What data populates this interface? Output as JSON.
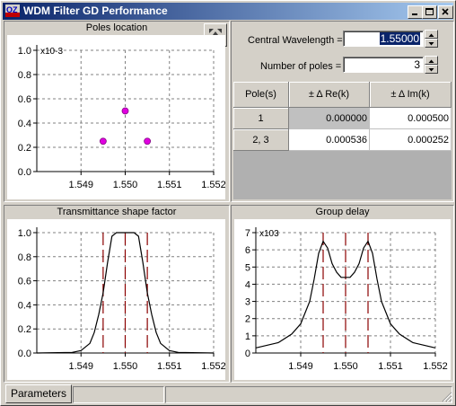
{
  "window": {
    "title": "WDM Filter GD Performance",
    "app_icon": "oz-app-icon",
    "buttons": [
      "minimize-icon",
      "maximize-icon",
      "close-icon"
    ]
  },
  "poles_plot": {
    "title": "Poles location",
    "y_exponent": "x10-3",
    "zoom_icon": "move-zoom-icon"
  },
  "params": {
    "central_wavelength_label": "Central Wavelength =",
    "central_wavelength_value": "1.55000",
    "num_poles_label": "Number of poles =",
    "num_poles_value": "3"
  },
  "pole_table": {
    "headers": [
      "Pole(s)",
      "± Δ Re(k)",
      "± Δ Im(k)"
    ],
    "rows": [
      [
        "1",
        "0.000000",
        "0.000500"
      ],
      [
        "2, 3",
        "0.000536",
        "0.000252"
      ]
    ]
  },
  "transmittance_plot": {
    "title": "Transmittance shape factor"
  },
  "group_delay_plot": {
    "title": "Group delay",
    "y_exponent": "x103"
  },
  "statusbar": {
    "tab_label": "Parameters"
  },
  "colors": {
    "marker": "#e000e0",
    "cutoff_line": "#8b0000",
    "title_bar": "#0a246a"
  },
  "chart_data": [
    {
      "type": "scatter",
      "title": "Poles location",
      "x_ticks": [
        "1.549",
        "1.550",
        "1.551",
        "1.552"
      ],
      "y_ticks": [
        "0.0",
        "0.2",
        "0.4",
        "0.6",
        "0.8",
        "1.0"
      ],
      "xlim": [
        1.548,
        1.552
      ],
      "ylim": [
        0,
        1.0
      ],
      "grid": true,
      "series": [
        {
          "x": [
            1.5495,
            1.55,
            1.5505
          ],
          "y": [
            0.25,
            0.5,
            0.25
          ]
        }
      ]
    },
    {
      "type": "line",
      "title": "Transmittance shape factor",
      "x_ticks": [
        "1.549",
        "1.550",
        "1.551",
        "1.552"
      ],
      "y_ticks": [
        "0.0",
        "0.2",
        "0.4",
        "0.6",
        "0.8",
        "1.0"
      ],
      "xlim": [
        1.548,
        1.552
      ],
      "ylim": [
        0,
        1.0
      ],
      "grid": true,
      "series": [
        {
          "x": [
            1.548,
            1.5488,
            1.549,
            1.5492,
            1.5493,
            1.5494,
            1.5495,
            1.5496,
            1.5497,
            1.5498,
            1.55,
            1.5502,
            1.5503,
            1.5504,
            1.5505,
            1.5506,
            1.5507,
            1.5508,
            1.551,
            1.5512,
            1.552
          ],
          "y": [
            0.0,
            0.005,
            0.02,
            0.08,
            0.17,
            0.32,
            0.5,
            0.75,
            0.97,
            1.0,
            1.0,
            1.0,
            0.97,
            0.75,
            0.5,
            0.32,
            0.17,
            0.08,
            0.02,
            0.005,
            0.0
          ]
        }
      ],
      "cutoff_lines_x": [
        1.5495,
        1.55,
        1.5505
      ]
    },
    {
      "type": "line",
      "title": "Group delay",
      "x_ticks": [
        "1.549",
        "1.550",
        "1.551",
        "1.552"
      ],
      "y_ticks": [
        "0",
        "1",
        "2",
        "3",
        "4",
        "5",
        "6",
        "7"
      ],
      "xlim": [
        1.548,
        1.552
      ],
      "ylim": [
        0,
        7
      ],
      "grid": true,
      "series": [
        {
          "x": [
            1.548,
            1.5485,
            1.5488,
            1.549,
            1.5492,
            1.5493,
            1.5494,
            1.5495,
            1.5496,
            1.5497,
            1.5498,
            1.5499,
            1.55,
            1.5501,
            1.5502,
            1.5503,
            1.5504,
            1.5505,
            1.5506,
            1.5507,
            1.5508,
            1.551,
            1.5512,
            1.5515,
            1.552
          ],
          "y": [
            0.3,
            0.6,
            1.1,
            1.7,
            3.0,
            4.3,
            5.8,
            6.5,
            6.1,
            5.2,
            4.7,
            4.4,
            4.4,
            4.4,
            4.7,
            5.2,
            6.1,
            6.5,
            5.8,
            4.3,
            3.0,
            1.7,
            1.1,
            0.6,
            0.3
          ]
        }
      ],
      "cutoff_lines_x": [
        1.5495,
        1.55,
        1.5505
      ]
    }
  ]
}
